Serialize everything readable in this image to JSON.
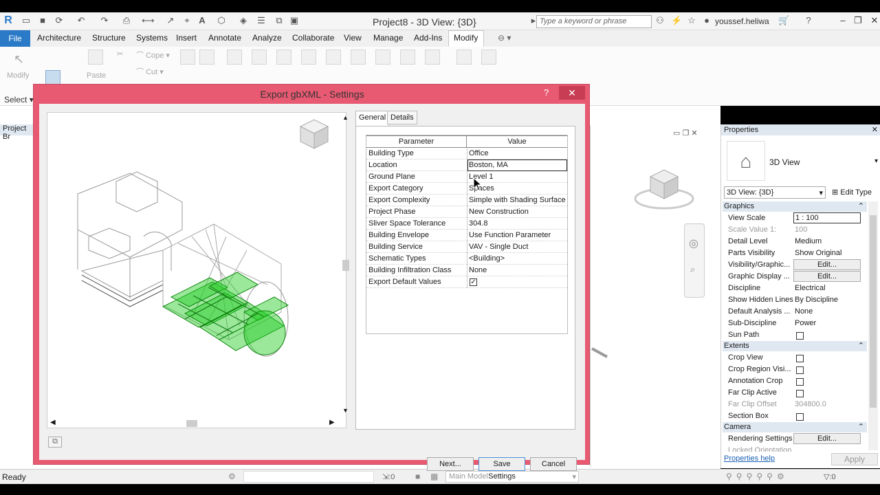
{
  "titlebar": {
    "app_title": "Project8 - 3D View: {3D}",
    "search_placeholder": "Type a keyword or phrase",
    "user": "youssef.heliwa"
  },
  "ribbon": {
    "tabs": [
      "File",
      "Architecture",
      "Structure",
      "Systems",
      "Insert",
      "Annotate",
      "Analyze",
      "Collaborate",
      "View",
      "Manage",
      "Add-Ins",
      "Modify"
    ],
    "modify_label": "Modify",
    "select_label": "Select",
    "paste_label": "Paste",
    "cope_label": "Cope",
    "cut_label": "Cut"
  },
  "project_browser": {
    "title": "Project Br"
  },
  "dialog": {
    "title": "Export gbXML - Settings",
    "tabs": [
      "General",
      "Details"
    ],
    "table_headers": {
      "parameter": "Parameter",
      "value": "Value"
    },
    "rows": [
      {
        "parameter": "Building Type",
        "value": "Office"
      },
      {
        "parameter": "Location",
        "value": "Boston, MA"
      },
      {
        "parameter": "Ground Plane",
        "value": "Level 1"
      },
      {
        "parameter": "Export Category",
        "value": "Spaces"
      },
      {
        "parameter": "Export Complexity",
        "value": "Simple with Shading Surface"
      },
      {
        "parameter": "Project Phase",
        "value": "New Construction"
      },
      {
        "parameter": "Sliver Space Tolerance",
        "value": "304.8"
      },
      {
        "parameter": "Building Envelope",
        "value": "Use Function Parameter"
      },
      {
        "parameter": "Building Service",
        "value": "VAV - Single Duct"
      },
      {
        "parameter": "Schematic Types",
        "value": "<Building>"
      },
      {
        "parameter": "Building Infiltration Class",
        "value": "None"
      },
      {
        "parameter": "Export Default Values",
        "value": ""
      }
    ],
    "buttons": {
      "next": "Next...",
      "save": "Save Settings",
      "cancel": "Cancel"
    }
  },
  "properties": {
    "title": "Properties",
    "type_label": "3D View",
    "view_select": "3D View: {3D}",
    "edit_type": "Edit Type",
    "sections": {
      "graphics": "Graphics",
      "extents": "Extents",
      "camera": "Camera"
    },
    "graphics_rows": [
      {
        "name": "View Scale",
        "value": "1 : 100"
      },
      {
        "name": "Scale Value    1:",
        "value": "100"
      },
      {
        "name": "Detail Level",
        "value": "Medium"
      },
      {
        "name": "Parts Visibility",
        "value": "Show Original"
      },
      {
        "name": "Visibility/Graphic...",
        "value": "Edit..."
      },
      {
        "name": "Graphic Display ...",
        "value": "Edit..."
      },
      {
        "name": "Discipline",
        "value": "Electrical"
      },
      {
        "name": "Show Hidden Lines",
        "value": "By Discipline"
      },
      {
        "name": "Default Analysis ...",
        "value": "None"
      },
      {
        "name": "Sub-Discipline",
        "value": "Power"
      },
      {
        "name": "Sun Path",
        "value": ""
      }
    ],
    "extents_rows": [
      {
        "name": "Crop View"
      },
      {
        "name": "Crop Region Visi..."
      },
      {
        "name": "Annotation Crop"
      },
      {
        "name": "Far Clip Active"
      },
      {
        "name": "Far Clip Offset",
        "value": "304800.0"
      },
      {
        "name": "Section Box"
      }
    ],
    "camera_rows": [
      {
        "name": "Rendering Settings",
        "value": "Edit..."
      },
      {
        "name": "Locked Orientation"
      }
    ],
    "help_link": "Properties help",
    "apply": "Apply"
  },
  "status": {
    "text": "Ready",
    "workset": "Main Model",
    "sel_count": ":0",
    "filter_count": ":0"
  },
  "colors": {
    "dialog_border": "#e85a72",
    "file_tab": "#2a7ac8",
    "model_highlight": "#22cc22"
  }
}
